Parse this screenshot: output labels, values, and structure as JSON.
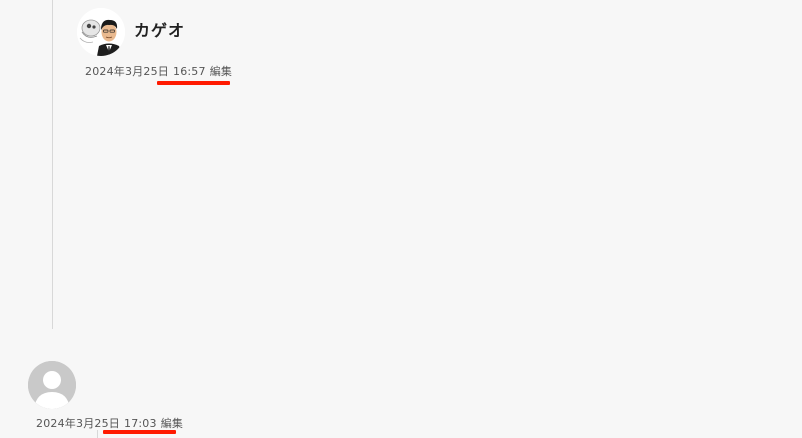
{
  "reply_comment": {
    "author": "カゲオ",
    "date": "2024年3月25日",
    "time": "16:57",
    "edit_label": "編集"
  },
  "comment": {
    "date": "2024年3月25日",
    "time": "17:03",
    "edit_label": "編集"
  },
  "highlight_color": "#ff1a00"
}
